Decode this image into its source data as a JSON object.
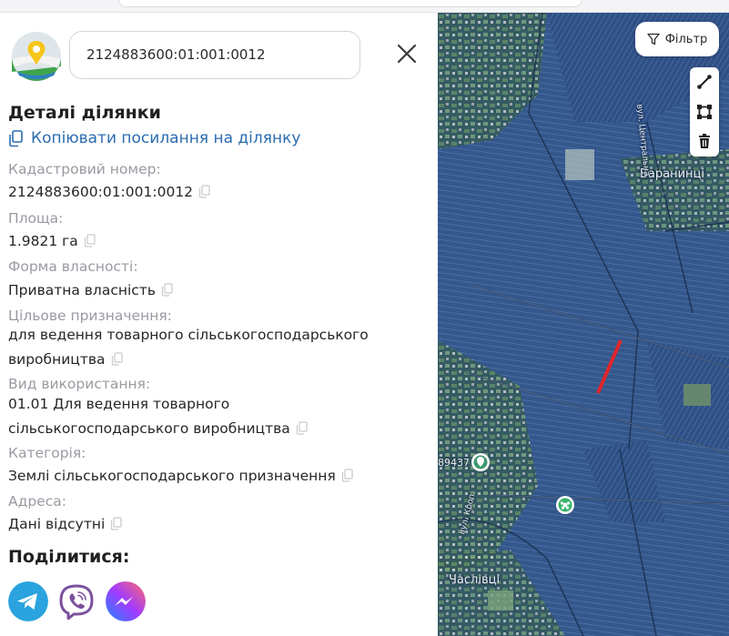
{
  "search": {
    "value": "2124883600:01:001:0012"
  },
  "details": {
    "title": "Деталі ділянки",
    "copy_link_label": "Копіювати посилання на ділянку",
    "fields": [
      {
        "label": "Кадастровий номер:",
        "value": "2124883600:01:001:0012"
      },
      {
        "label": "Площа:",
        "value": "1.9821 га"
      },
      {
        "label": "Форма власності:",
        "value": "Приватна власність"
      },
      {
        "label": "Цільове призначення:",
        "value": "для ведення товарного сільськогосподарського виробництва"
      },
      {
        "label": "Вид використання:",
        "value": "01.01 Для ведення товарного сільськогосподарського виробництва"
      },
      {
        "label": "Категорія:",
        "value": "Землі сільськогосподарського призначення"
      },
      {
        "label": "Адреса:",
        "value": "Дані відсутні"
      }
    ]
  },
  "share": {
    "title": "Поділитися:",
    "buttons": [
      {
        "name": "telegram",
        "icon": "telegram-icon",
        "color": "#2aa3df"
      },
      {
        "name": "viber",
        "icon": "viber-icon",
        "color": "#7b519d"
      },
      {
        "name": "messenger",
        "icon": "messenger-icon",
        "color": "#7a4dff"
      }
    ]
  },
  "map": {
    "filter_label": "Фільтр",
    "tools": [
      "draw-line-icon",
      "draw-polygon-icon",
      "trash-icon"
    ],
    "labels": {
      "village_1": "Баранинці",
      "village_2": "Часлівці",
      "street_1": "вул. Центральна",
      "street_2": "вул. Кроп",
      "edge_number": "89437"
    },
    "colors": {
      "parcel_overlay": "#3a5f96",
      "highlight_parcel": "#e0262b",
      "link": "#2b6cb0"
    }
  }
}
